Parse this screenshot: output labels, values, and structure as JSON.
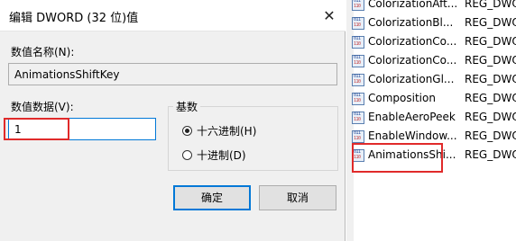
{
  "dialog": {
    "title": "编辑 DWORD (32 位)值",
    "close_glyph": "✕",
    "value_name_label": "数值名称(N):",
    "value_name": "AnimationsShiftKey",
    "value_data_label": "数值数据(V):",
    "value_data": "1",
    "base_group_label": "基数",
    "radio_hex_label": "十六进制(H)",
    "radio_dec_label": "十进制(D)",
    "ok_label": "确定",
    "cancel_label": "取消"
  },
  "registry_list": {
    "items": [
      {
        "name": "ColorizationAft...",
        "type": "REG_DWO"
      },
      {
        "name": "ColorizationBl...",
        "type": "REG_DWO"
      },
      {
        "name": "ColorizationCo...",
        "type": "REG_DWO"
      },
      {
        "name": "ColorizationCo...",
        "type": "REG_DWO"
      },
      {
        "name": "ColorizationGl...",
        "type": "REG_DWO"
      },
      {
        "name": "Composition",
        "type": "REG_DWO"
      },
      {
        "name": "EnableAeroPeek",
        "type": "REG_DWO"
      },
      {
        "name": "EnableWindow...",
        "type": "REG_DWO"
      },
      {
        "name": "AnimationsShi...",
        "type": "REG_DWO"
      }
    ]
  },
  "colors": {
    "highlight_box": "#e02a2a",
    "accent": "#0078d7"
  }
}
